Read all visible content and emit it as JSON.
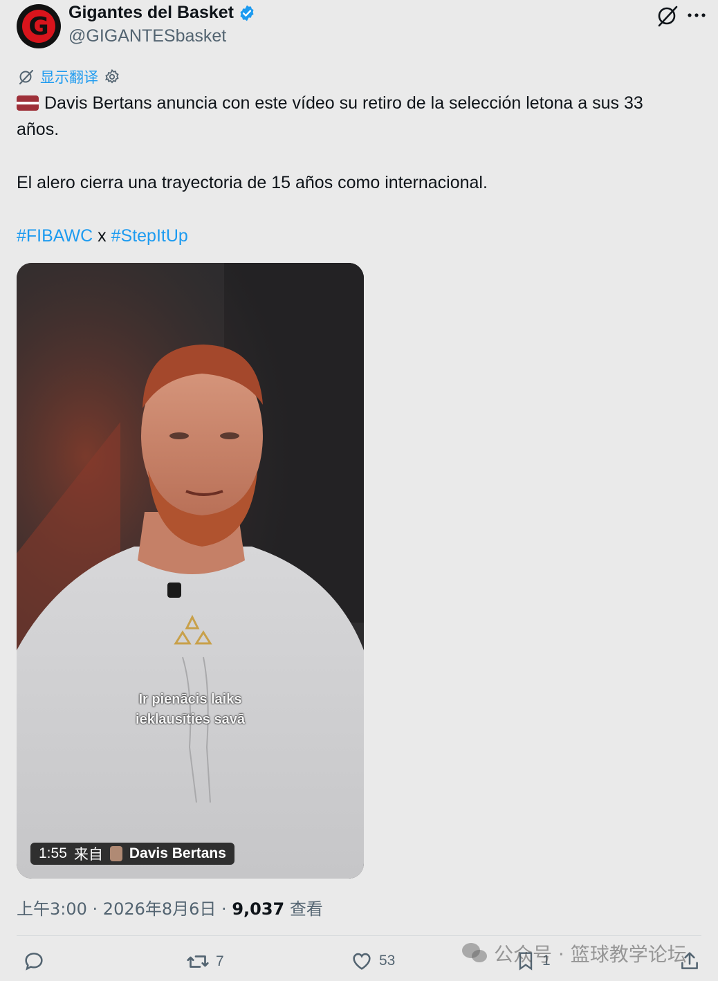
{
  "author": {
    "avatar_letter": "G",
    "name": "Gigantes del Basket",
    "handle": "@GIGANTESbasket",
    "verified_icon": "verified-badge-icon"
  },
  "header_actions": [
    "grok-icon",
    "more-icon"
  ],
  "translate": {
    "label": "显示翻译"
  },
  "post": {
    "line1": "Davis Bertans anuncia con este vídeo su retiro de la selección letona a sus 33",
    "line2": "años.",
    "line3": "El alero cierra una trayectoria de 15 años como internacional.",
    "hashtag1": "#FIBAWC",
    "separator": "x",
    "hashtag2": "#StepItUp"
  },
  "video": {
    "subtitle_line1": "Ir pienācis laiks",
    "subtitle_line2": "ieklausīties savā",
    "duration": "1:55",
    "from_label": "来自",
    "source_name": "Davis Bertans"
  },
  "meta": {
    "time": "上午3:00",
    "date": "2026年8月6日",
    "views": "9,037",
    "views_label": "查看"
  },
  "actions": {
    "retweets": "7",
    "likes": "53",
    "bookmarks": "1"
  },
  "watermark": {
    "text": "公众号 · 篮球教学论坛"
  },
  "colors": {
    "accent": "#1d9bf0",
    "background": "#eaeaea",
    "text": "#0f1419",
    "muted": "#536471"
  }
}
